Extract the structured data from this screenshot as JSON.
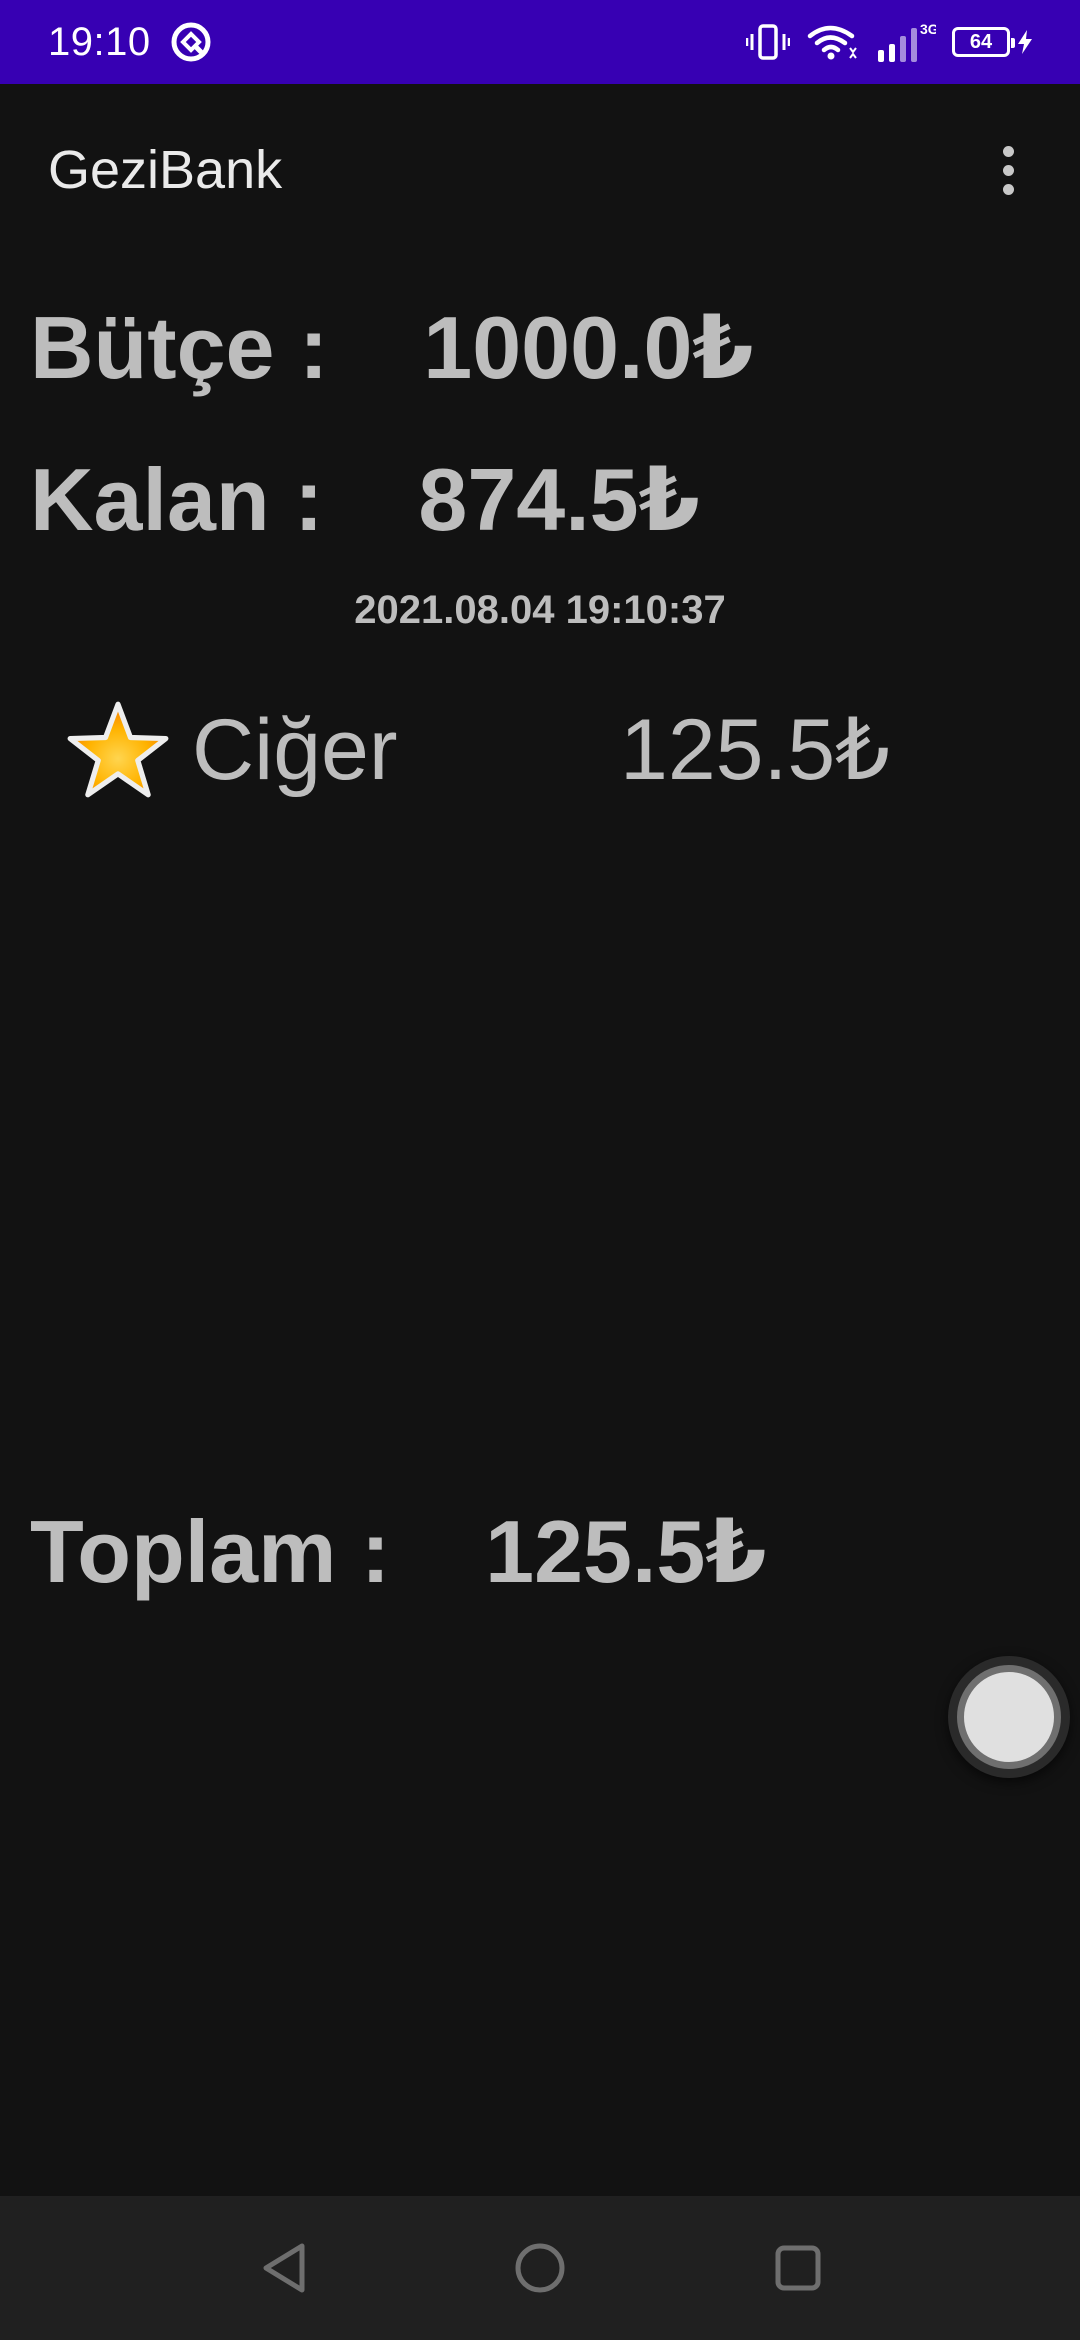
{
  "status_bar": {
    "time": "19:10",
    "network": "3G",
    "battery": "64",
    "background": "#3700b3"
  },
  "app_bar": {
    "title": "GeziBank"
  },
  "budget": {
    "label": "Bütçe :",
    "value": "1000.0₺"
  },
  "remaining": {
    "label": "Kalan :",
    "value": "874.5₺"
  },
  "datetime": "2021.08.04 19:10:37",
  "expenses": [
    {
      "icon": "star-icon",
      "name": "Ciğer",
      "amount": "125.5₺"
    }
  ],
  "total": {
    "label": "Toplam :",
    "value": "125.5₺"
  },
  "fab": {
    "icon": "circle-button-icon"
  },
  "nav": {
    "back": "back-icon",
    "home": "home-icon",
    "recents": "recents-icon"
  }
}
